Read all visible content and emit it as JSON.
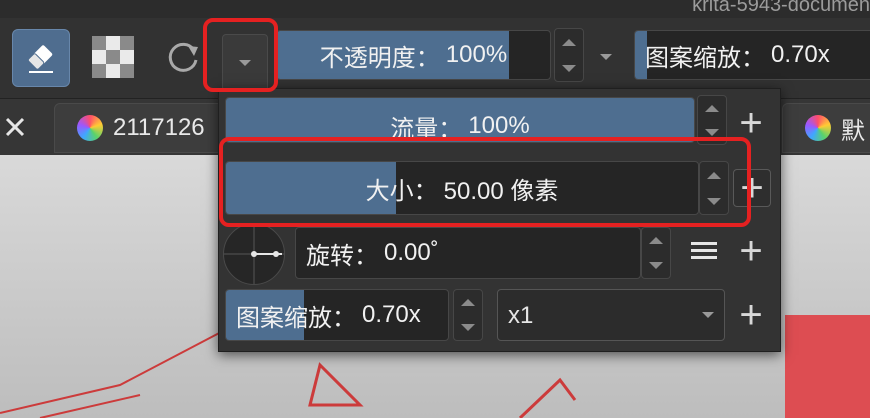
{
  "window": {
    "title": "krita-5943-documen"
  },
  "toolbar": {
    "opacity": {
      "label": "不透明度：",
      "value": "100%",
      "fill": 0.85
    },
    "pattern_scale": {
      "label": "图案缩放：",
      "value": "0.70x",
      "fill": 0.05
    }
  },
  "tabs": [
    {
      "label": "2117126"
    },
    {
      "label": "默"
    }
  ],
  "panel": {
    "flow": {
      "label": "流量：",
      "value": "100%",
      "fill": 1.0
    },
    "size": {
      "label": "大小：",
      "value": "50.00 像素",
      "fill": 0.36
    },
    "rotation": {
      "label": "旋转：",
      "value": "0.00˚"
    },
    "pattern_scale": {
      "label": "图案缩放：",
      "value": "0.70x",
      "fill": 0.35
    },
    "multiplier": {
      "selected": "x1"
    },
    "plus": "+"
  },
  "icons": [
    "eraser-icon",
    "alpha-lock-icon",
    "reset-icon",
    "close-icon",
    "color-wheel-icon",
    "menu-icon",
    "plus-icon"
  ],
  "colors": {
    "accent": "#4e6e90",
    "highlight": "#e52121"
  }
}
